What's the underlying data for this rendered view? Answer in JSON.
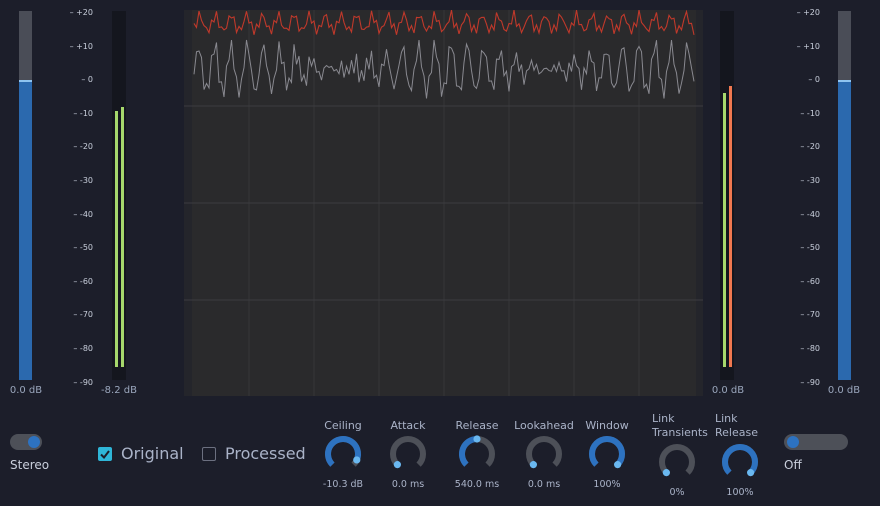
{
  "left": {
    "input_fader": {
      "level_percent": 81,
      "value_label": "0.0 dB"
    },
    "meter": {
      "value_label": "-8.2 dB",
      "bars": [
        {
          "level_percent": 72,
          "color": "#a6d86c"
        },
        {
          "level_percent": 73,
          "color": "#a6d86c"
        }
      ]
    },
    "scale": [
      "+20",
      "+10",
      "0",
      "-10",
      "-20",
      "-30",
      "-40",
      "-50",
      "-60",
      "-70",
      "-80",
      "-90"
    ]
  },
  "right": {
    "output_fader": {
      "level_percent": 81,
      "value_label": "0.0 dB"
    },
    "meter": {
      "value_label": "0.0 dB",
      "bars": [
        {
          "level_percent": 77,
          "color": "#a6d86c"
        },
        {
          "level_percent": 79,
          "color": "#f07850"
        }
      ]
    },
    "scale": [
      "+20",
      "+10",
      "0",
      "-10",
      "-20",
      "-30",
      "-40",
      "-50",
      "-60",
      "-70",
      "-80",
      "-90"
    ]
  },
  "controls": {
    "stereo": {
      "label": "Stereo",
      "state": "on"
    },
    "original": {
      "label": "Original",
      "checked": true
    },
    "processed": {
      "label": "Processed",
      "checked": false
    },
    "off": {
      "label": "Off",
      "state": "off"
    },
    "knobs": [
      {
        "label": "Ceiling",
        "value": "-10.3 dB",
        "fraction": 0.92
      },
      {
        "label": "Attack",
        "value": "0.0 ms",
        "fraction": 0.0
      },
      {
        "label": "Release",
        "value": "540.0 ms",
        "fraction": 0.5
      },
      {
        "label": "Lookahead",
        "value": "0.0 ms",
        "fraction": 0.0
      },
      {
        "label": "Window",
        "value": "100%",
        "fraction": 1.0
      },
      {
        "label": "Link Transients",
        "value": "0%",
        "fraction": 0.0
      },
      {
        "label": "Link Release",
        "value": "100%",
        "fraction": 1.0
      }
    ]
  },
  "colors": {
    "accent": "#2d72c0",
    "knob_dot": "#6ab8f0",
    "processed_wave": "#c0392b",
    "original_wave": "#9a9aa2"
  }
}
